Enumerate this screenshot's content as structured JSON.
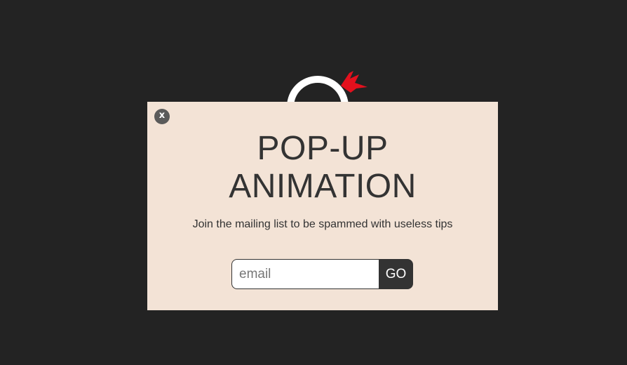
{
  "popup": {
    "close_label": "x",
    "title_line1": "POP-UP",
    "title_line2": "ANIMATION",
    "subtitle": "Join the mailing list to be spammed with useless tips",
    "email_placeholder": "email",
    "email_value": "",
    "go_label": "GO"
  },
  "background": {
    "mascot_icon": "ninja-mascot-icon"
  },
  "colors": {
    "page_background": "#232323",
    "popup_background": "#f3e3d6",
    "text": "#333333",
    "close_button": "#5a5a5a",
    "go_button": "#333333",
    "headband": "#e3101d"
  }
}
